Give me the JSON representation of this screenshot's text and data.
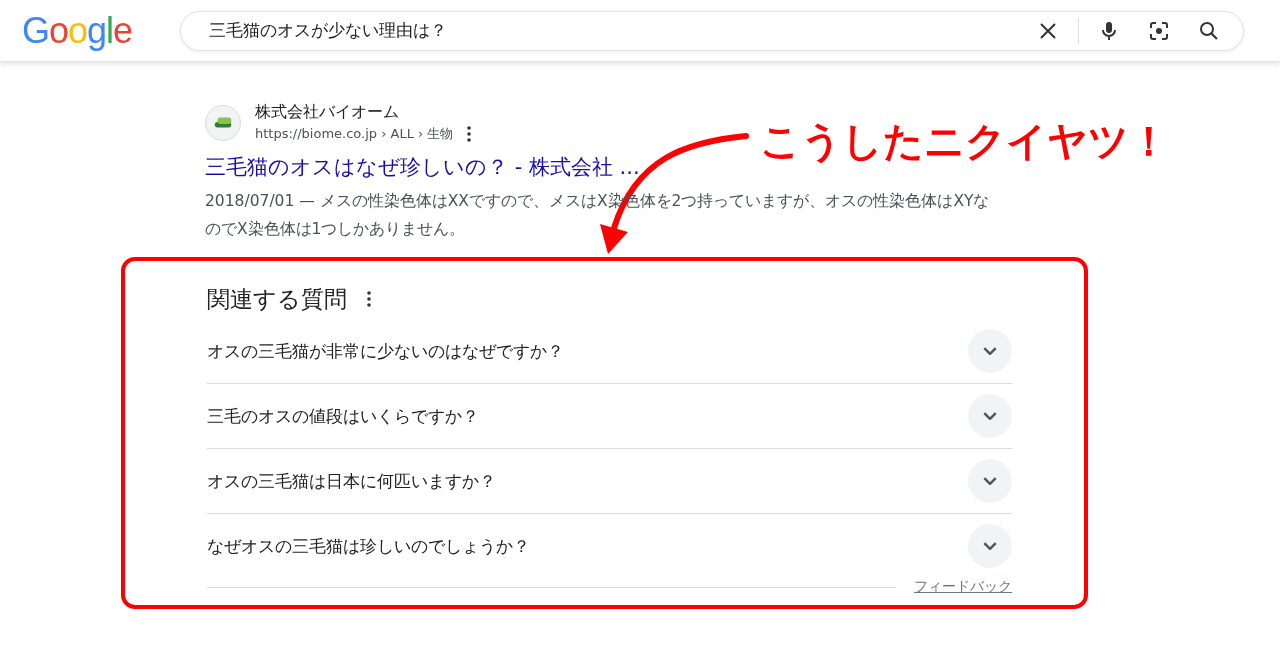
{
  "header": {
    "logo": "Google",
    "search": {
      "value": "三毛猫のオスが少ない理由は？"
    }
  },
  "result": {
    "site_name": "株式会社バイオーム",
    "url": "https://biome.co.jp › ALL › 生物",
    "title": "三毛猫のオスはなぜ珍しいの？ - 株式会社 ...",
    "snippet": "2018/07/01 — メスの性染色体はXXですので、メスはX染色体を2つ持っていますが、オスの性染色体はXYなのでX染色体は1つしかありません。"
  },
  "related_questions": {
    "heading": "関連する質問",
    "items": [
      {
        "text": "オスの三毛猫が非常に少ないのはなぜですか？",
        "expanded": false
      },
      {
        "text": "三毛のオスの値段はいくらですか？",
        "expanded": false
      },
      {
        "text": "オスの三毛猫は日本に何匹いますか？",
        "expanded": false
      },
      {
        "text": "なぜオスの三毛猫は珍しいのでしょうか？",
        "expanded": false
      }
    ],
    "feedback": "フィードバック"
  },
  "annotation": {
    "text": "こうしたニクイヤツ！"
  }
}
